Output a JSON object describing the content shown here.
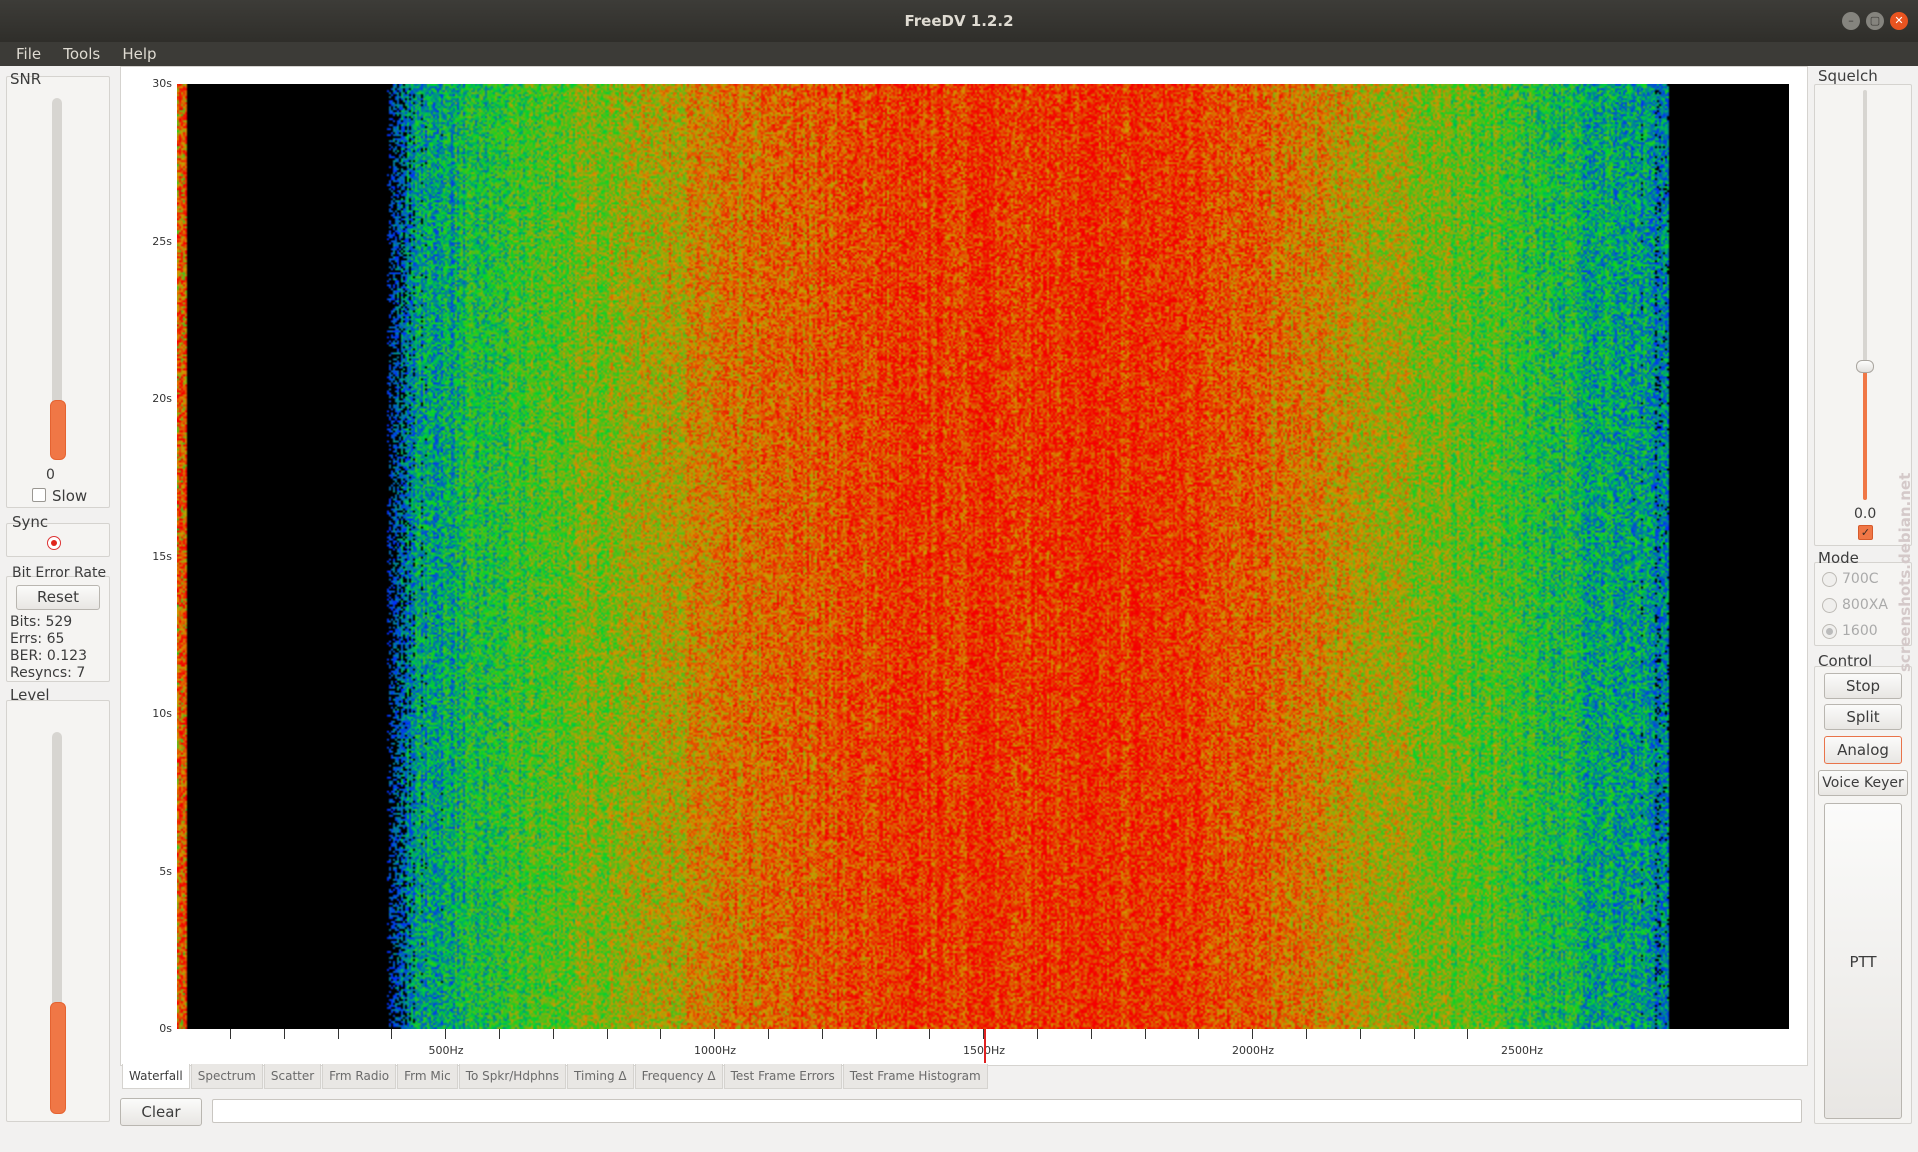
{
  "window": {
    "title": "FreeDV 1.2.2"
  },
  "menu": [
    "File",
    "Tools",
    "Help"
  ],
  "snr": {
    "label": "SNR",
    "value": "0",
    "slow_label": "Slow",
    "level_fraction": 0.16
  },
  "sync": {
    "label": "Sync"
  },
  "ber": {
    "label": "Bit Error Rate",
    "reset_label": "Reset",
    "bits": "Bits: 529",
    "errs": "Errs: 65",
    "ber": "BER: 0.123",
    "resyncs": "Resyncs: 7"
  },
  "level": {
    "label": "Level",
    "level_fraction": 0.29
  },
  "waterfall": {
    "y_ticks": [
      "30s",
      "25s",
      "20s",
      "15s",
      "10s",
      "5s",
      "0s"
    ],
    "x_ticks": [
      "500Hz",
      "1000Hz",
      "1500Hz",
      "2000Hz",
      "2500Hz"
    ],
    "marker_hz": 1500
  },
  "tabs": [
    "Waterfall",
    "Spectrum",
    "Scatter",
    "Frm Radio",
    "Frm Mic",
    "To Spkr/Hdphns",
    "Timing Δ",
    "Frequency Δ",
    "Test Frame Errors",
    "Test Frame Histogram"
  ],
  "bottom": {
    "clear_label": "Clear",
    "message": ""
  },
  "squelch": {
    "label": "Squelch",
    "value": "0.0",
    "level_fraction": 0.33,
    "enabled": true
  },
  "mode": {
    "label": "Mode",
    "options": [
      "700C",
      "800XA",
      "1600"
    ],
    "selected": "1600"
  },
  "control": {
    "label": "Control",
    "stop_label": "Stop",
    "split_label": "Split",
    "analog_label": "Analog",
    "voice_keyer_label": "Voice Keyer",
    "ptt_label": "PTT"
  },
  "watermark": "screenshots.debian.net"
}
